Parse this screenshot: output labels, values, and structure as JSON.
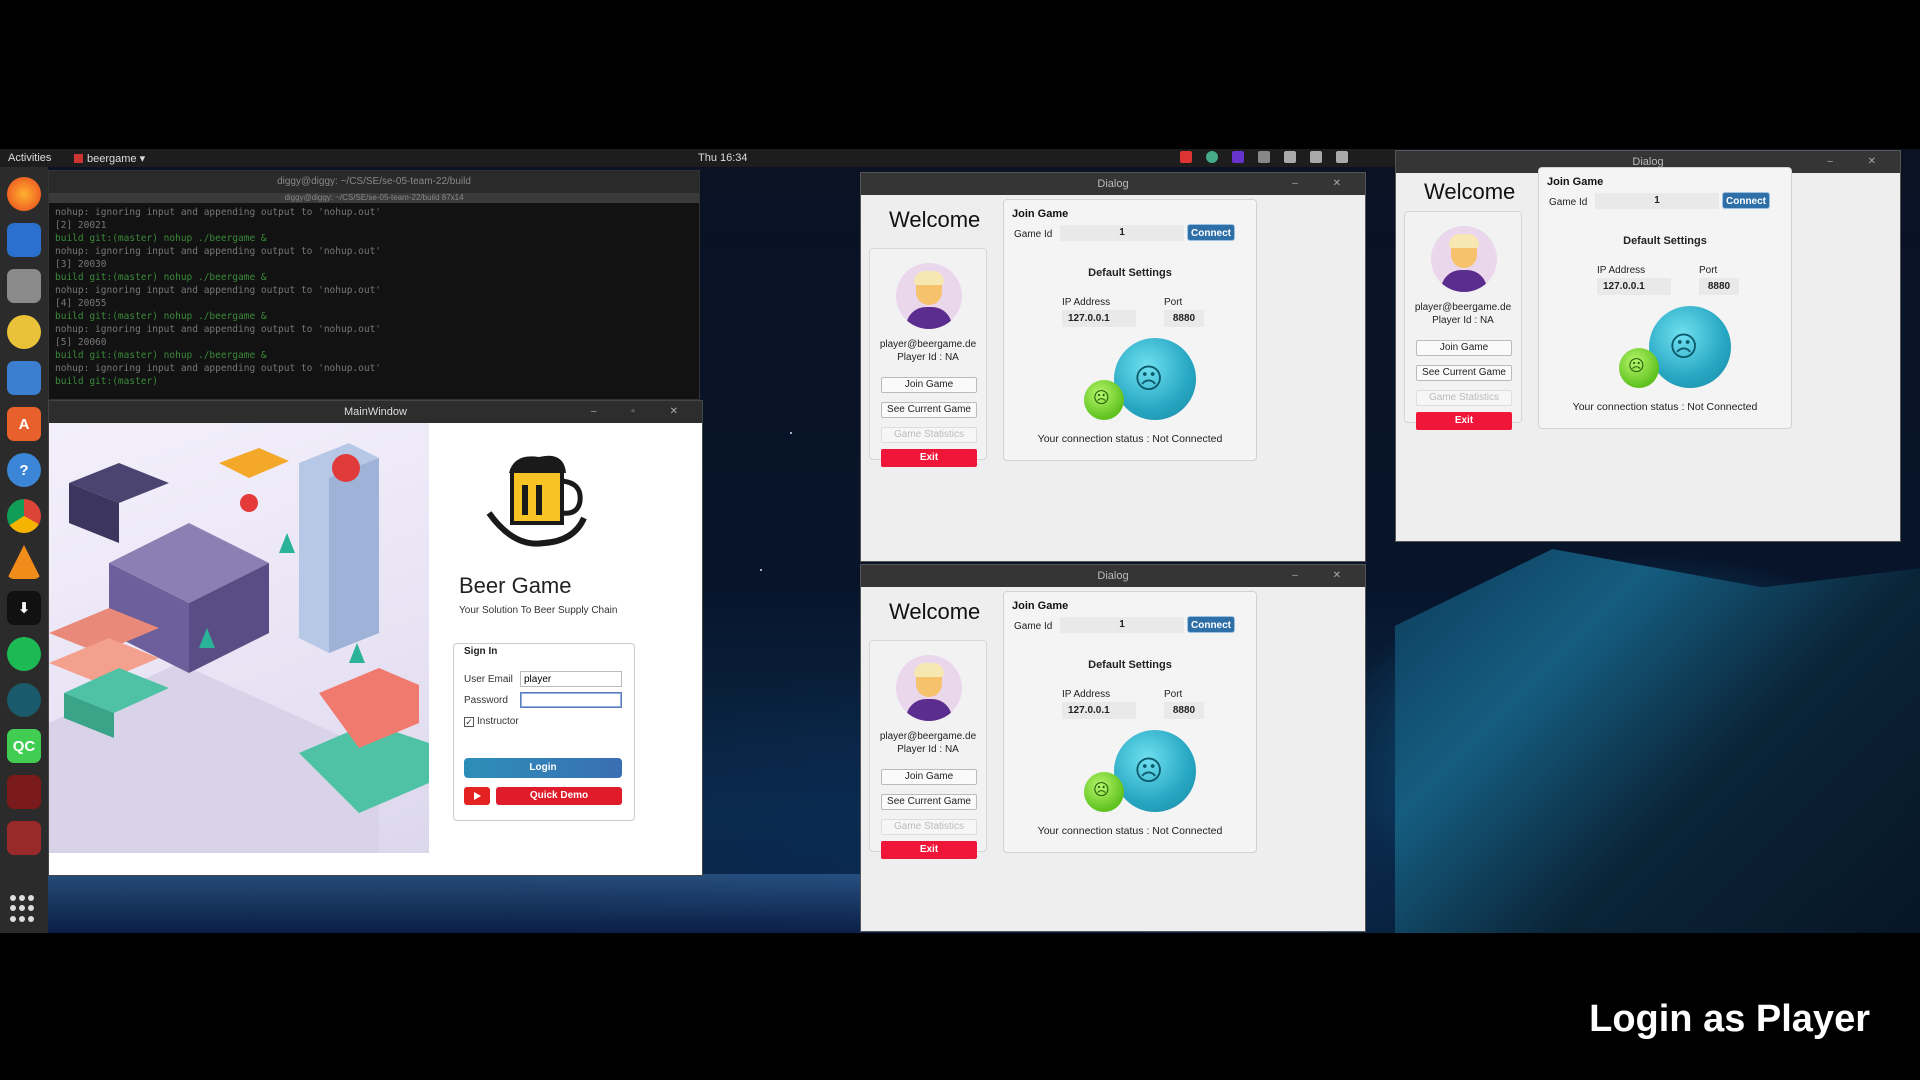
{
  "topbar": {
    "activities": "Activities",
    "app": "beergame",
    "clock": "Thu 16:34"
  },
  "dock": {
    "icons": [
      "firefox-icon",
      "thunderbird-icon",
      "files-icon",
      "rhythmbox-icon",
      "writer-icon",
      "software-icon",
      "help-icon",
      "chrome-icon",
      "vlc-icon",
      "downloader-icon",
      "spotify-icon",
      "vpn-icon",
      "qt-creator-icon",
      "terminal-icon",
      "screen-recorder-icon"
    ]
  },
  "terminal": {
    "title": "diggy@diggy: ~/CS/SE/se-05-team-22/build",
    "subtitle": "diggy@diggy: ~/CS/SE/se-05-team-22/build 87x14",
    "lines": [
      "nohup: ignoring input and appending output to 'nohup.out'",
      "[2] 20021",
      "  build git:(master) nohup ./beergame &",
      "nohup: ignoring input and appending output to 'nohup.out'",
      "[3] 20030",
      "  build git:(master) nohup ./beergame &",
      "nohup: ignoring input and appending output to 'nohup.out'",
      "[4] 20055",
      "  build git:(master) nohup ./beergame &",
      "nohup: ignoring input and appending output to 'nohup.out'",
      "[5] 20060",
      "  build git:(master) nohup ./beergame &",
      "nohup: ignoring input and appending output to 'nohup.out'",
      "  build git:(master) "
    ]
  },
  "mainwindow": {
    "title": "MainWindow",
    "app_name": "Beer Game",
    "tagline": "Your Solution To Beer Supply Chain",
    "signin_legend": "Sign In",
    "email_label": "User Email",
    "email_value": "player",
    "password_label": "Password",
    "password_value": "",
    "instructor_label": "Instructor",
    "instructor_checked": true,
    "login_label": "Login",
    "demo_label": "Quick Demo"
  },
  "dialogs": [
    {
      "title": "Dialog",
      "welcome": "Welcome",
      "email": "player@beergame.de",
      "player_id": "Player Id :   NA",
      "join_game_btn": "Join Game",
      "see_current_btn": "See Current Game",
      "stats_btn": "Game Statistics",
      "exit_btn": "Exit",
      "join_title": "Join Game",
      "game_id_label": "Game Id",
      "game_id_value": "1",
      "connect_label": "Connect",
      "defaults_title": "Default Settings",
      "ip_label": "IP Address",
      "ip_value": "127.0.0.1",
      "port_label": "Port",
      "port_value": "8880",
      "status": "Your connection status :  Not Connected"
    },
    {
      "title": "Dialog",
      "welcome": "Welcome",
      "email": "player@beergame.de",
      "player_id": "Player Id :   NA",
      "join_game_btn": "Join Game",
      "see_current_btn": "See Current Game",
      "stats_btn": "Game Statistics",
      "exit_btn": "Exit",
      "join_title": "Join Game",
      "game_id_label": "Game Id",
      "game_id_value": "1",
      "connect_label": "Connect",
      "defaults_title": "Default Settings",
      "ip_label": "IP Address",
      "ip_value": "127.0.0.1",
      "port_label": "Port",
      "port_value": "8880",
      "status": "Your connection status :  Not Connected"
    },
    {
      "title": "Dialog",
      "welcome": "Welcome",
      "email": "player@beergame.de",
      "player_id": "Player Id :   NA",
      "join_game_btn": "Join Game",
      "see_current_btn": "See Current Game",
      "stats_btn": "Game Statistics",
      "exit_btn": "Exit",
      "join_title": "Join Game",
      "game_id_label": "Game Id",
      "game_id_value": "1",
      "connect_label": "Connect",
      "defaults_title": "Default Settings",
      "ip_label": "IP Address",
      "ip_value": "127.0.0.1",
      "port_label": "Port",
      "port_value": "8880",
      "status": "Your connection status :  Not Connected"
    }
  ],
  "caption": "Login as Player",
  "colors": {
    "accent_red": "#f0163a",
    "connect_blue": "#2f6fa8",
    "login_gradient": "#2c8fb8"
  }
}
